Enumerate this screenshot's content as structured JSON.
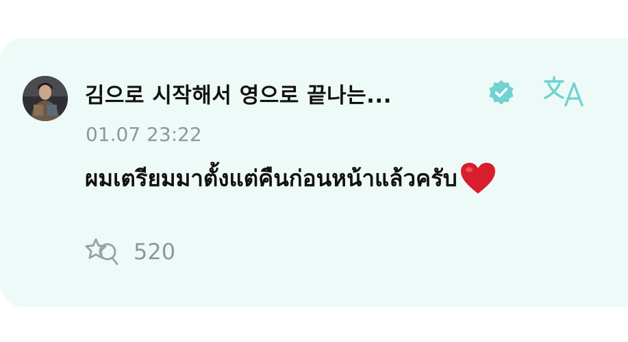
{
  "comment": {
    "username": "김으로 시작해서 영으로 끝나는...",
    "timestamp": "01.07 23:22",
    "message": "ผมเตรียมมาตั้งแต่คืนก่อนหน้าแล้วครับ",
    "like_count": "520"
  },
  "icons": {
    "verified": "verified-badge-icon",
    "translate": "translate-icon",
    "heart": "red-heart-emoji",
    "like": "star-heart-like-icon"
  },
  "colors": {
    "card_background": "#eefaf7",
    "accent": "#6fd3d0",
    "text_primary": "#111111",
    "text_secondary": "#8e9699",
    "heart": "#d81e2c"
  }
}
